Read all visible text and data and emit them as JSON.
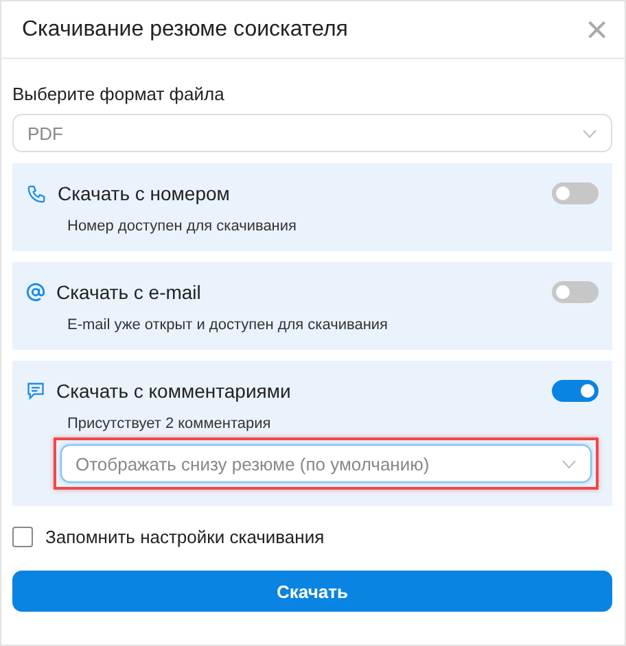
{
  "dialog": {
    "title": "Скачивание резюме соискателя",
    "close": "×"
  },
  "format": {
    "label": "Выберите формат файла",
    "value": "PDF"
  },
  "options": [
    {
      "kind": "phone",
      "title": "Скачать с номером",
      "hint": "Номер доступен для скачивания",
      "on": false
    },
    {
      "kind": "email",
      "title": "Скачать с e-mail",
      "hint": "E-mail уже открыт и доступен для скачивания",
      "on": false
    },
    {
      "kind": "comments",
      "title": "Скачать с комментариями",
      "hint": "Присутствует 2 комментария",
      "on": true,
      "select": {
        "placeholder": "Отображать снизу резюме (по умолчанию)",
        "highlighted": true
      }
    }
  ],
  "remember": {
    "label": "Запомнить настройки скачивания",
    "checked": false
  },
  "submit": "Скачать"
}
